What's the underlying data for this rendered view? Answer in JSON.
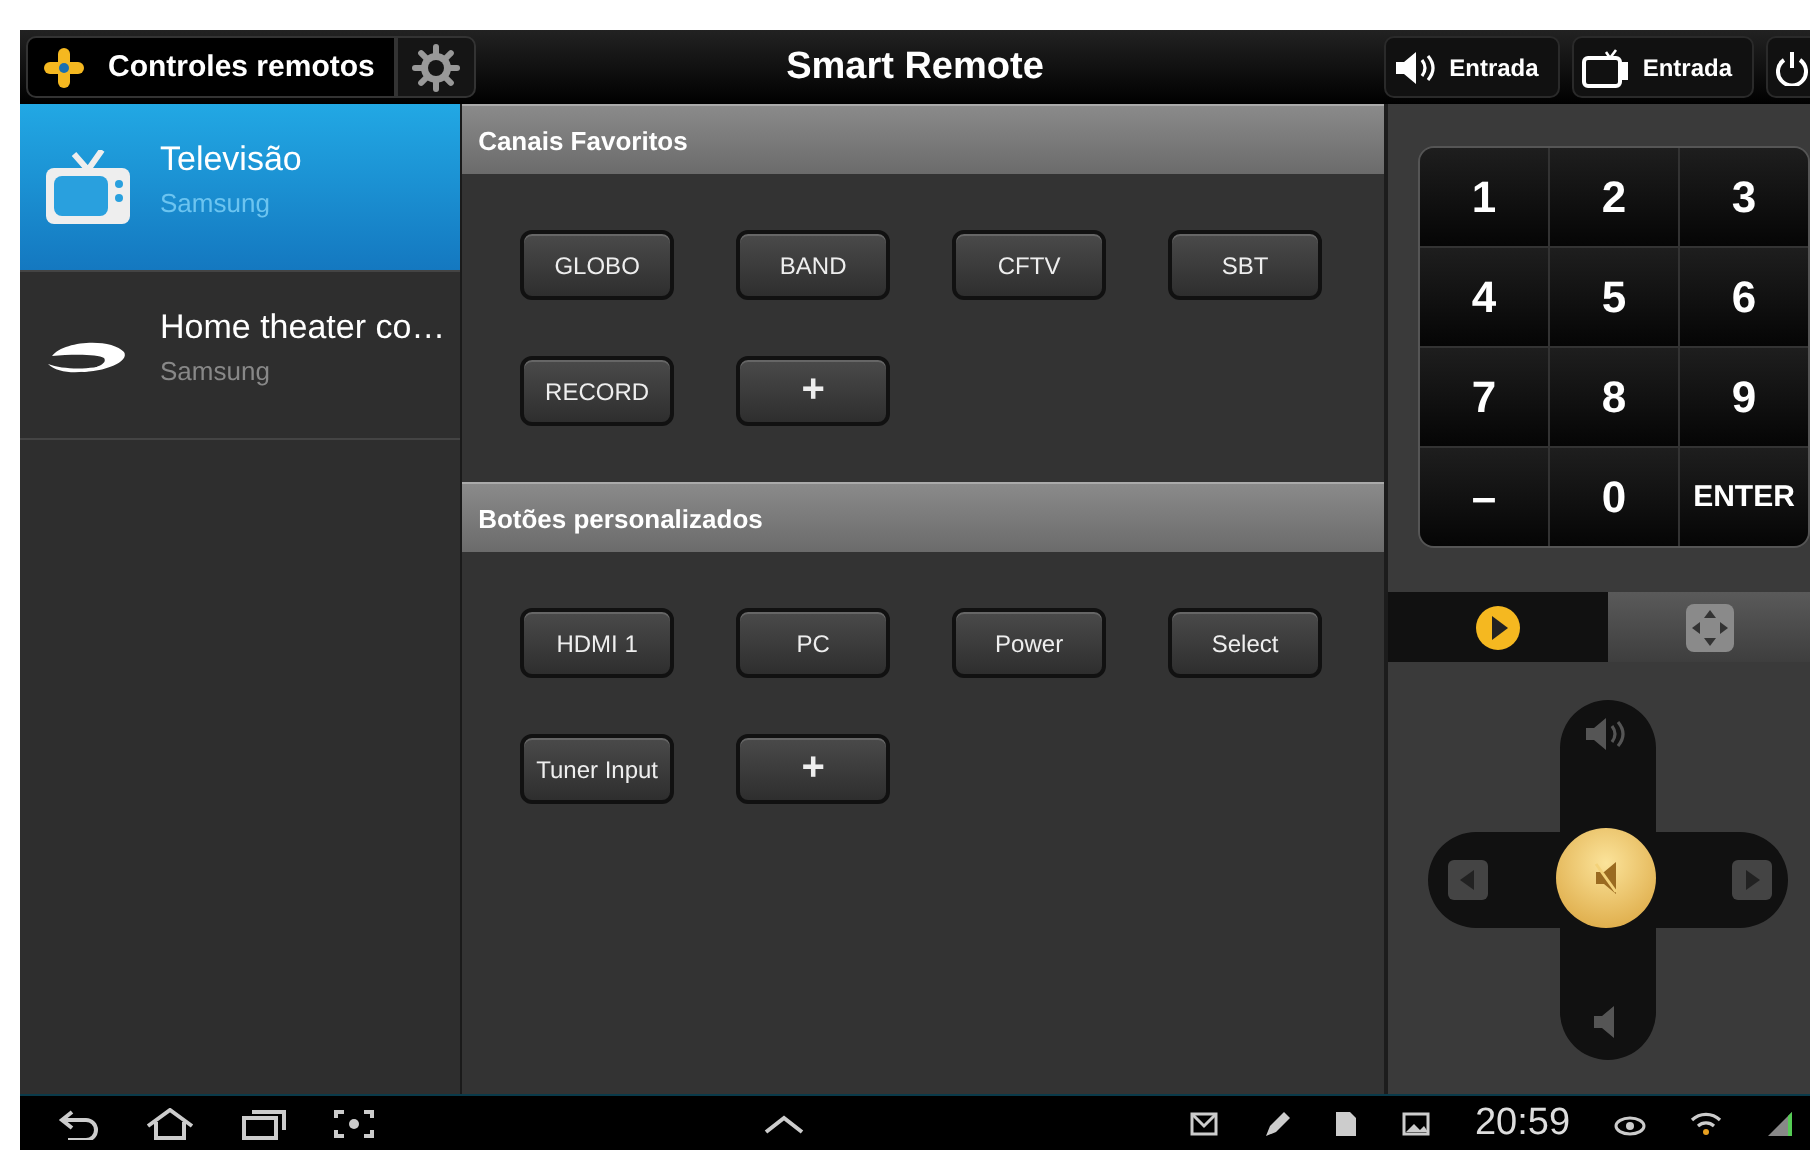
{
  "top_bar": {
    "app_button": "Controles remotos",
    "title": "Smart Remote",
    "actions": [
      {
        "kind": "audio",
        "label": "Entrada"
      },
      {
        "kind": "tv",
        "label": "Entrada"
      }
    ]
  },
  "devices": [
    {
      "kind": "tv",
      "name": "Televisão",
      "brand": "Samsung",
      "selected": true
    },
    {
      "kind": "disc",
      "name": "Home theater co…",
      "brand": "Samsung",
      "selected": false
    }
  ],
  "sections": [
    {
      "title": "Canais Favoritos",
      "buttons": [
        "GLOBO",
        "BAND",
        "CFTV",
        "SBT",
        "RECORD",
        "+"
      ]
    },
    {
      "title": "Botões personalizados",
      "buttons": [
        "HDMI 1",
        "PC",
        "Power",
        "Select",
        "Tuner Input",
        "+"
      ]
    }
  ],
  "keypad": [
    "1",
    "2",
    "3",
    "4",
    "5",
    "6",
    "7",
    "8",
    "9",
    "–",
    "0",
    "ENTER"
  ],
  "remote_tabs": [
    {
      "kind": "play",
      "selected": true
    },
    {
      "kind": "arrows",
      "selected": false
    }
  ],
  "status_bar": {
    "time": "20:59"
  }
}
